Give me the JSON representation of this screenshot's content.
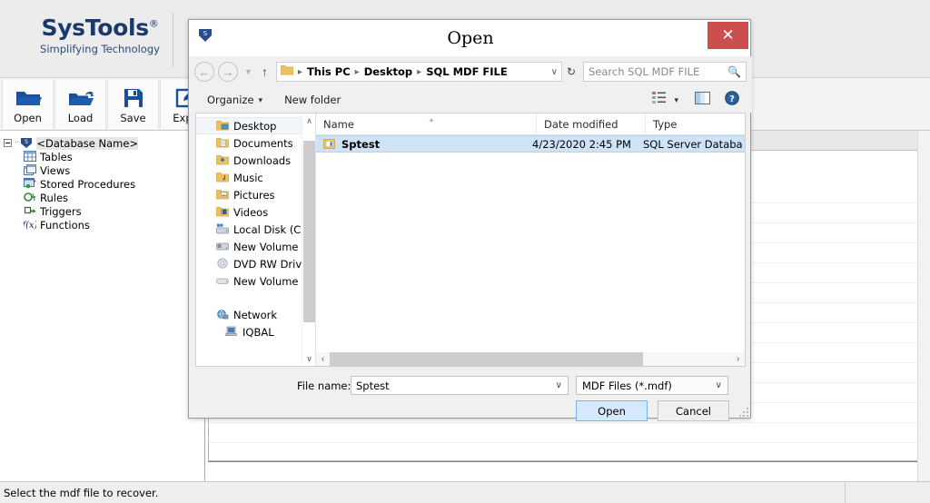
{
  "app": {
    "brand_name": "SysTools",
    "brand_reg": "®",
    "brand_tagline": "Simplifying Technology",
    "toolbar": [
      {
        "label": "Open",
        "icon": "open-folder-icon"
      },
      {
        "label": "Load",
        "icon": "load-folder-icon"
      },
      {
        "label": "Save",
        "icon": "floppy-save-icon"
      },
      {
        "label": "Expo",
        "icon": "export-pencil-icon"
      }
    ],
    "tree": {
      "root_label": "<Database Name>",
      "root_icon": "database-shield-icon",
      "children": [
        {
          "label": "Tables",
          "icon": "table-grid-icon"
        },
        {
          "label": "Views",
          "icon": "views-icon"
        },
        {
          "label": "Stored Procedures",
          "icon": "stored-procedures-icon"
        },
        {
          "label": "Rules",
          "icon": "rules-icon"
        },
        {
          "label": "Triggers",
          "icon": "triggers-icon"
        },
        {
          "label": "Functions",
          "icon": "functions-icon"
        }
      ]
    },
    "statusbar": {
      "message": "Select the mdf file to recover."
    }
  },
  "dialog": {
    "title": "Open",
    "app_icon": "systools-shield-icon",
    "close_label": "✕",
    "nav": {
      "back_icon": "arrow-left-icon",
      "forward_icon": "arrow-right-icon",
      "history_icon": "chevron-down-icon",
      "up_icon": "arrow-up-icon",
      "folder_icon": "folder-icon",
      "breadcrumbs": [
        "This PC",
        "Desktop",
        "SQL MDF FILE"
      ],
      "separator": "▸",
      "dropdown_icon": "chevron-down-icon",
      "refresh_icon": "refresh-icon",
      "refresh_glyph": "↻"
    },
    "search": {
      "placeholder": "Search SQL MDF FILE",
      "icon": "search-icon"
    },
    "commandbar": {
      "organize": "Organize",
      "organize_caret": "▾",
      "new_folder": "New folder",
      "view_icon": "list-view-icon",
      "view_caret": "▾",
      "preview_icon": "preview-pane-icon",
      "help_icon": "help-icon"
    },
    "nav_pane": {
      "items": [
        {
          "label": "Desktop",
          "icon": "desktop-folder-icon",
          "active": true
        },
        {
          "label": "Documents",
          "icon": "documents-folder-icon",
          "active": false
        },
        {
          "label": "Downloads",
          "icon": "downloads-folder-icon",
          "active": false
        },
        {
          "label": "Music",
          "icon": "music-folder-icon",
          "active": false
        },
        {
          "label": "Pictures",
          "icon": "pictures-folder-icon",
          "active": false
        },
        {
          "label": "Videos",
          "icon": "videos-folder-icon",
          "active": false
        },
        {
          "label": "Local Disk (C:)",
          "icon": "local-disk-icon",
          "active": false
        },
        {
          "label": "New Volume (D:)",
          "icon": "drive-icon",
          "active": false
        },
        {
          "label": "DVD RW Drive (E:",
          "icon": "dvd-drive-icon",
          "active": false
        },
        {
          "label": "New Volume (F:)",
          "icon": "drive-icon",
          "active": false
        },
        {
          "label": "",
          "icon": "",
          "active": false
        },
        {
          "label": "Network",
          "icon": "network-icon",
          "active": false
        },
        {
          "label": "IQBAL",
          "icon": "computer-icon",
          "active": false
        }
      ],
      "scroll_up": "∧",
      "scroll_down": "∨"
    },
    "file_list": {
      "columns": [
        "Name",
        "Date modified",
        "Type"
      ],
      "sort_indicator": "▴",
      "rows": [
        {
          "name": "Sptest",
          "date_modified": "4/23/2020 2:45 PM",
          "type": "SQL Server Databa...",
          "icon": "mdf-file-icon",
          "selected": true
        }
      ],
      "hscroll_left": "‹",
      "hscroll_right": "›"
    },
    "footer": {
      "filename_label": "File name:",
      "filename_value": "Sptest",
      "filename_caret": "∨",
      "filter_value": "MDF Files (*.mdf)",
      "filter_caret": "∨",
      "open_button": "Open",
      "cancel_button": "Cancel"
    }
  },
  "colors": {
    "brand_blue": "#1b3a6b",
    "close_red": "#cb4f4f",
    "selection_blue": "#cfe3f7",
    "open_button_blue": "#d6e9fb"
  }
}
